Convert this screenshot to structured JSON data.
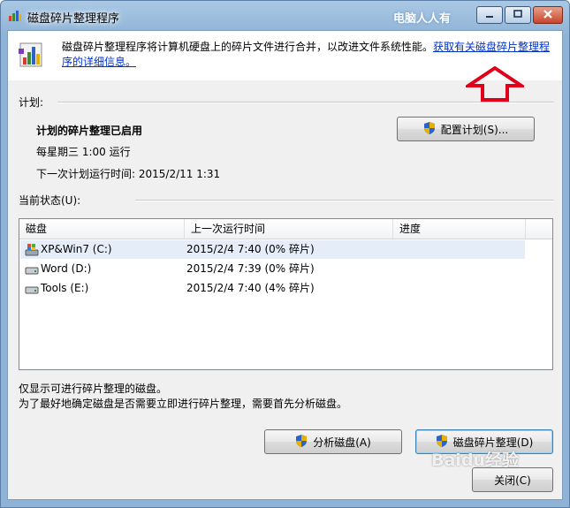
{
  "window": {
    "title": "磁盘碎片整理程序",
    "watermark_top": "电脑人人有",
    "controls": [
      "minimize-icon",
      "maximize-icon",
      "close-icon"
    ]
  },
  "header": {
    "description": "磁盘碎片整理程序将计算机硬盘上的碎片文件进行合并，以改进文件系统性能。",
    "link": "获取有关磁盘碎片整理程序的详细信息。",
    "icon": "defrag-app-icon"
  },
  "schedule": {
    "section_label": "计划:",
    "status": "计划的碎片整理已启用",
    "frequency": "每星期三  1:00 运行",
    "next_run": "下一次计划运行时间: 2015/2/11 1:31",
    "configure_button": "配置计划(S)..."
  },
  "current_status": {
    "section_label": "当前状态(U):",
    "columns": [
      "磁盘",
      "上一次运行时间",
      "进度"
    ],
    "rows": [
      {
        "disk": "XP&Win7 (C:)",
        "last_run": "2015/2/4 7:40 (0% 碎片)",
        "progress": "",
        "icon": "system-drive-icon"
      },
      {
        "disk": "Word (D:)",
        "last_run": "2015/2/4 7:39 (0% 碎片)",
        "progress": "",
        "icon": "hard-drive-icon"
      },
      {
        "disk": "Tools (E:)",
        "last_run": "2015/2/4 7:40 (4% 碎片)",
        "progress": "",
        "icon": "hard-drive-icon"
      }
    ]
  },
  "notes": {
    "line1": "仅显示可进行碎片整理的磁盘。",
    "line2": "为了最好地确定磁盘是否需要立即进行碎片整理，需要首先分析磁盘。"
  },
  "buttons": {
    "analyze": "分析磁盘(A)",
    "defragment": "磁盘碎片整理(D)",
    "close": "关闭(C)"
  },
  "watermark_bottom": "Baidu经验",
  "colors": {
    "link": "#0033cc",
    "arrow": "#e0001a",
    "selected_row": "#e5eef8"
  }
}
